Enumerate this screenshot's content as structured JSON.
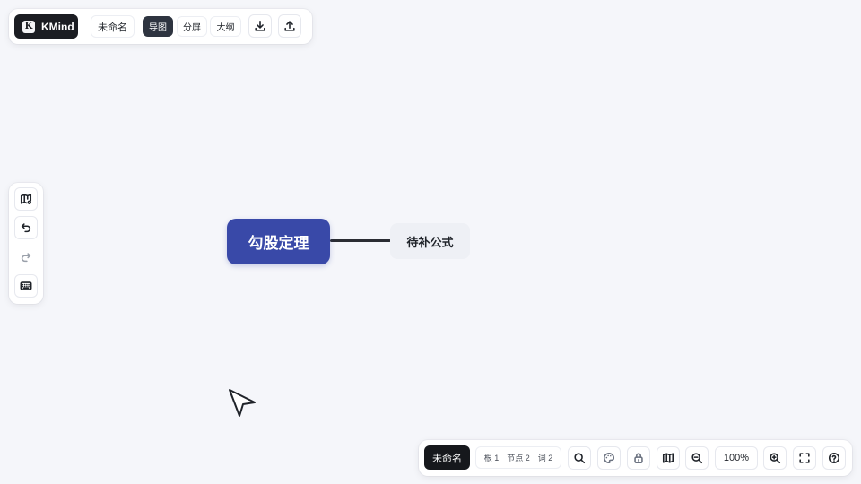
{
  "app": {
    "brand_name": "KMind",
    "brand_logo_letter": "K",
    "document_title": "未命名"
  },
  "view_modes": {
    "items": [
      {
        "label": "导图",
        "active": true
      },
      {
        "label": "分屏",
        "active": false
      },
      {
        "label": "大纲",
        "active": false
      }
    ]
  },
  "toolbar_icons": {
    "download": "download-icon",
    "upload": "upload-icon"
  },
  "left_tools": {
    "items": [
      {
        "icon": "map-settings-icon",
        "enabled": true
      },
      {
        "icon": "undo-icon",
        "enabled": true
      },
      {
        "icon": "redo-icon",
        "enabled": false
      },
      {
        "icon": "keyboard-icon",
        "enabled": true
      }
    ]
  },
  "mindmap": {
    "root": {
      "label": "勾股定理",
      "color": "#3949a8"
    },
    "children": [
      {
        "label": "待补公式"
      }
    ]
  },
  "bottom_bar": {
    "document_title": "未命名",
    "stats": {
      "root": "根 1",
      "nodes": "节点 2",
      "words": "词 2"
    },
    "zoom_level": "100%",
    "icons": [
      "search-icon",
      "theme-palette-icon",
      "lock-icon",
      "minimap-icon",
      "zoom-out-icon",
      "zoom-in-icon",
      "fullscreen-icon",
      "help-icon"
    ]
  },
  "colors": {
    "background": "#f5f6fa",
    "accent": "#3949a8",
    "dark": "#16181c"
  }
}
